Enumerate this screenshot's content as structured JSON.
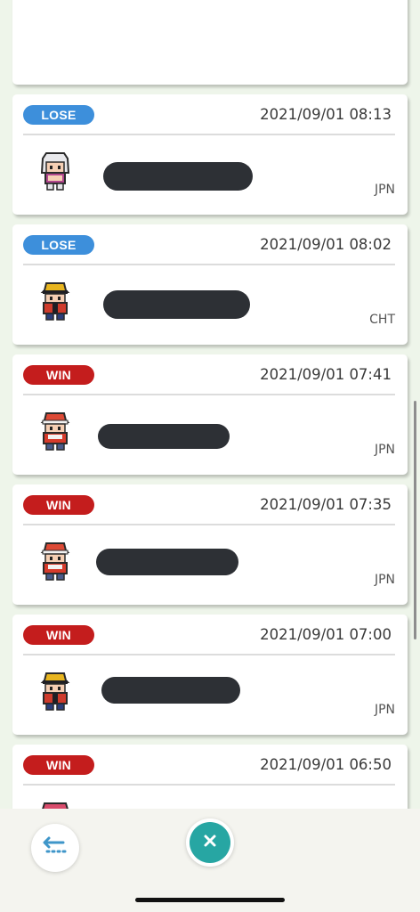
{
  "colors": {
    "lose_badge": "#3d8fdb",
    "win_badge": "#c41d1d",
    "close_button": "#27a6a3",
    "back_icon": "#3f96c9"
  },
  "matches": [
    {
      "result": "LOSE",
      "timestamp": "2021/09/01 08:13",
      "region": "JPN",
      "opponent_sprite": "trainer-white-hair",
      "name_redacted": true
    },
    {
      "result": "LOSE",
      "timestamp": "2021/09/01 08:02",
      "region": "CHT",
      "opponent_sprite": "trainer-yellow-cap",
      "name_redacted": true
    },
    {
      "result": "WIN",
      "timestamp": "2021/09/01 07:41",
      "region": "JPN",
      "opponent_sprite": "trainer-red-cap",
      "name_redacted": true
    },
    {
      "result": "WIN",
      "timestamp": "2021/09/01 07:35",
      "region": "JPN",
      "opponent_sprite": "trainer-red-cap",
      "name_redacted": true
    },
    {
      "result": "WIN",
      "timestamp": "2021/09/01 07:00",
      "region": "JPN",
      "opponent_sprite": "trainer-yellow-cap",
      "name_redacted": true
    },
    {
      "result": "WIN",
      "timestamp": "2021/09/01 06:50",
      "region": "",
      "opponent_sprite": "trainer-pink-hair",
      "name_redacted": true
    }
  ],
  "bottom_bar": {
    "back_icon": "back-arrow-icon",
    "close_icon": "close-x-icon"
  }
}
